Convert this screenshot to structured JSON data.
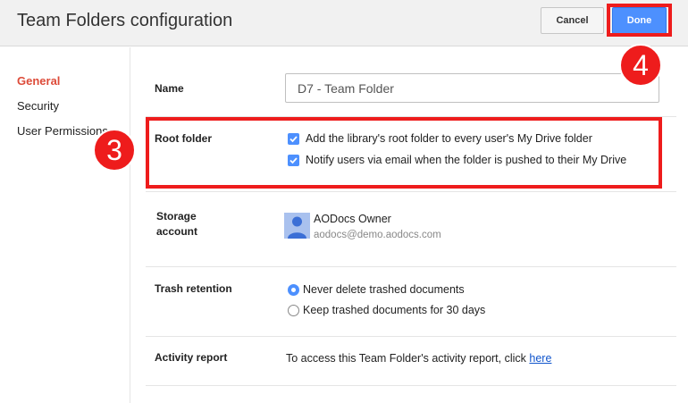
{
  "header": {
    "title": "Team Folders configuration",
    "cancel_label": "Cancel",
    "done_label": "Done"
  },
  "sidebar": {
    "items": [
      {
        "label": "General",
        "active": true
      },
      {
        "label": "Security",
        "active": false
      },
      {
        "label": "User Permissions",
        "active": false
      }
    ]
  },
  "form": {
    "name": {
      "label": "Name",
      "value": "D7 - Team Folder"
    },
    "root_folder": {
      "label": "Root folder",
      "options": [
        {
          "label": "Add the library's root folder to every user's My Drive folder",
          "checked": true
        },
        {
          "label": "Notify users via email when the folder is pushed to their My Drive",
          "checked": true
        }
      ]
    },
    "storage_account": {
      "label_line1": "Storage",
      "label_line2": "account",
      "owner_name": "AODocs Owner",
      "owner_email": "aodocs@demo.aodocs.com"
    },
    "trash_retention": {
      "label": "Trash retention",
      "options": [
        {
          "label": "Never delete trashed documents",
          "selected": true
        },
        {
          "label": "Keep trashed documents for 30 days",
          "selected": false
        }
      ]
    },
    "activity_report": {
      "label": "Activity report",
      "text": "To access this Team Folder's activity report, click",
      "link": "here"
    }
  },
  "annotations": [
    {
      "step": "3"
    },
    {
      "step": "4"
    }
  ],
  "colors": {
    "accent": "#4d90fe",
    "active_nav": "#dd4b39",
    "annotation": "#ee1c1c",
    "link": "#1155cc"
  }
}
